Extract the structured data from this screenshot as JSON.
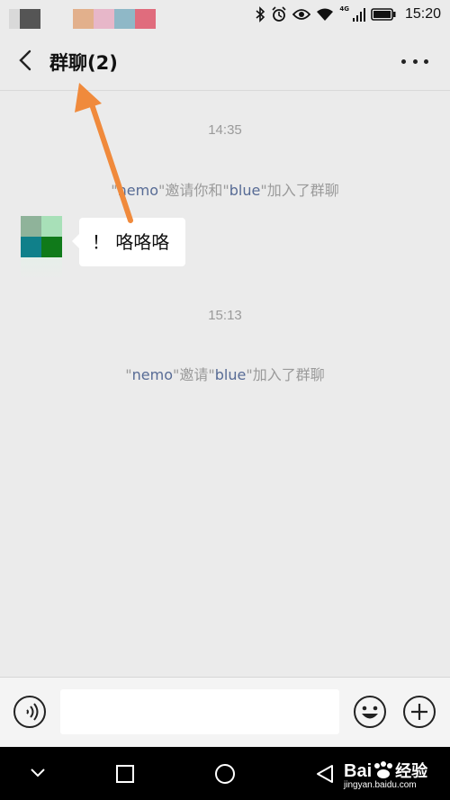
{
  "status_bar": {
    "time": "15:20",
    "network_label": "4G",
    "icons": [
      "bluetooth-icon",
      "alarm-icon",
      "eye-icon",
      "wifi-icon",
      "signal-icon",
      "battery-icon"
    ],
    "blurred_colors": [
      "#d9d9d9",
      "#555555",
      "#ebebeb",
      "#e2b08c",
      "#e7b7c9",
      "#8fb8c7",
      "#e06c7d"
    ]
  },
  "header": {
    "title": "群聊(2)",
    "back_icon": "chevron-left-icon",
    "more_icon": "more-dots-icon"
  },
  "messages": [
    {
      "type": "time",
      "text": "14:35"
    },
    {
      "type": "system",
      "q1": "\"",
      "name1": "nemo",
      "mid": "\"邀请你和\"",
      "name2": "blue",
      "end": "\"加入了群聊"
    },
    {
      "type": "bubble",
      "text": "！ 咯咯咯",
      "avatar_colors": [
        "#8fb39a",
        "#a8e0b8",
        "#10808a",
        "#107a1a"
      ]
    },
    {
      "type": "time",
      "text": "15:13"
    },
    {
      "type": "system",
      "q1": "\"",
      "name1": "nemo",
      "mid": "\"邀请\"",
      "name2": "blue",
      "end": "\"加入了群聊"
    }
  ],
  "input_bar": {
    "voice_icon": "voice-icon",
    "input_value": "",
    "emoji_icon": "emoji-icon",
    "plus_icon": "plus-icon"
  },
  "nav_bar": {
    "icons": [
      "nav-down-icon",
      "nav-recent-icon",
      "nav-home-icon",
      "nav-back-icon"
    ]
  },
  "watermark": {
    "brand": "Bai",
    "brand_suffix": "经验",
    "url": "jingyan.baidu.com"
  },
  "colors": {
    "background": "#ebebeb",
    "name_link": "#576b95",
    "annotation_arrow": "#f08a3c"
  }
}
